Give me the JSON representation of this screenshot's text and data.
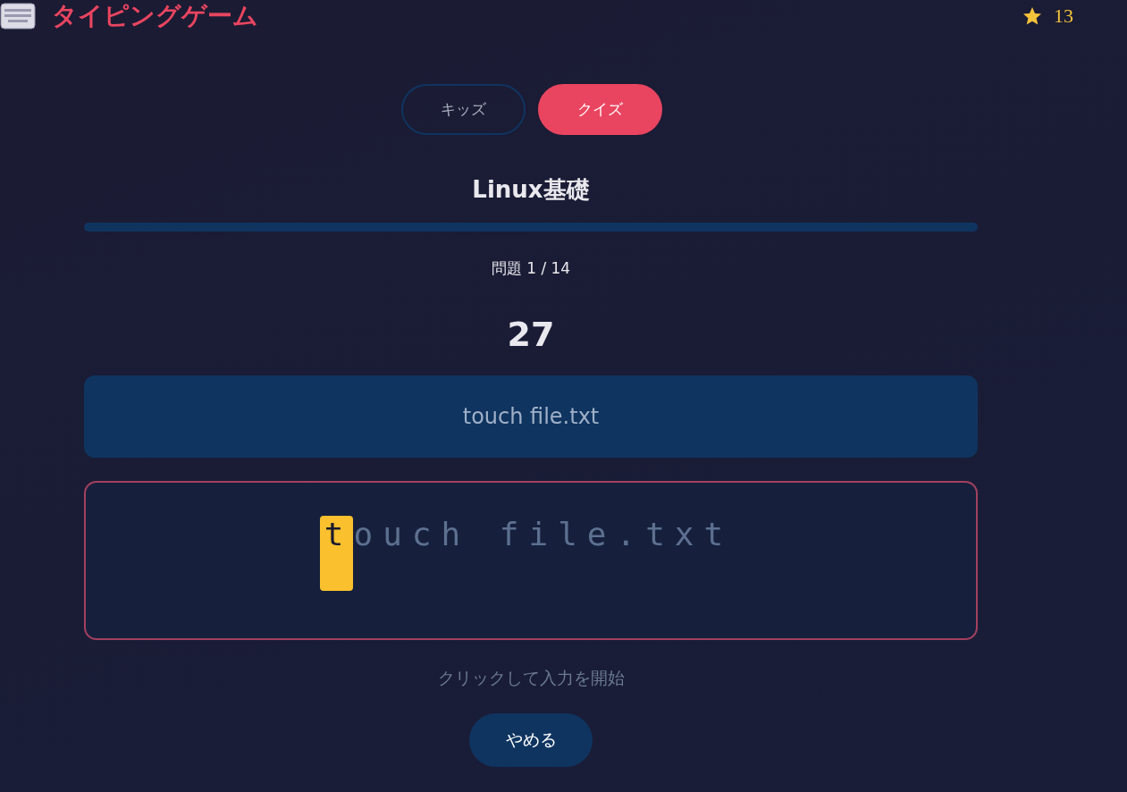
{
  "header": {
    "title": "タイピングゲーム",
    "stars_count": "13"
  },
  "tabs": [
    {
      "label": "キッズ",
      "selected": false
    },
    {
      "label": "クイズ",
      "selected": true
    }
  ],
  "quiz": {
    "title": "Linux基礎",
    "progress": {
      "level": 0
    },
    "counter": "問題 1 / 14",
    "timer": "27",
    "prompt": "touch file.txt",
    "typing": {
      "current": "t",
      "remaining": "ouch file.txt"
    },
    "hint": "クリックして入力を開始",
    "quit_button": "やめる"
  }
}
